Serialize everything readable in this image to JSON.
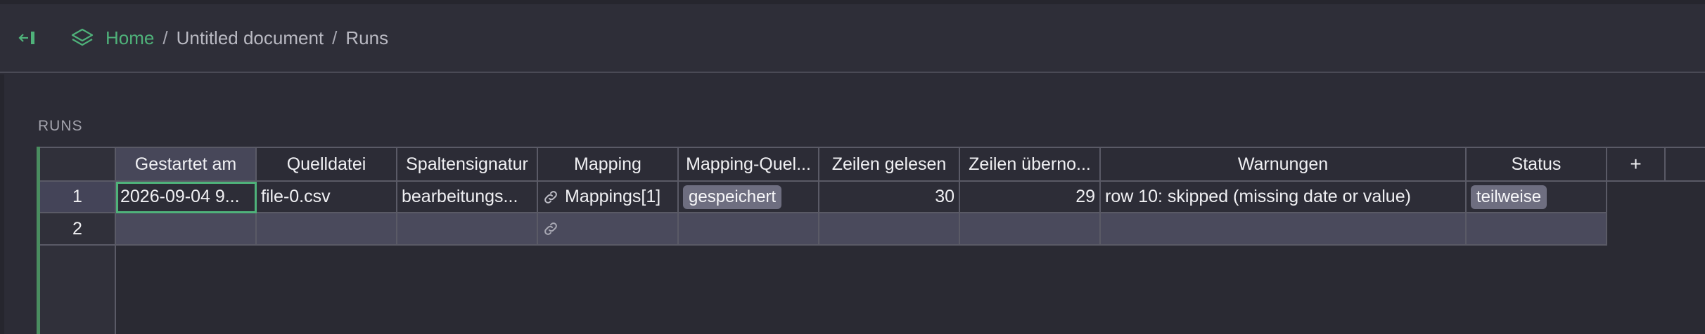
{
  "breadcrumb": {
    "home": "Home",
    "separator": "/",
    "document": "Untitled document",
    "current": "Runs"
  },
  "section": {
    "label": "RUNS"
  },
  "table": {
    "columns": [
      "Gestartet am",
      "Quelldatei",
      "Spaltensignatur",
      "Mapping",
      "Mapping-Quel...",
      "Zeilen gelesen",
      "Zeilen überno...",
      "Warnungen",
      "Status"
    ],
    "add_column": "+",
    "rows": [
      {
        "num": "1",
        "gestartet_am": "2026-09-04 9...",
        "quelldatei": "file-0.csv",
        "spaltensignatur": "bearbeitungs...",
        "mapping": "Mappings[1]",
        "mapping_quelle": "gespeichert",
        "zeilen_gelesen": "30",
        "zeilen_uebernommen": "29",
        "warnungen": "row 10: skipped (missing date or value)",
        "status": "teilweise"
      },
      {
        "num": "2",
        "gestartet_am": "",
        "quelldatei": "",
        "spaltensignatur": "",
        "mapping": "",
        "mapping_quelle": "",
        "zeilen_gelesen": "",
        "zeilen_uebernommen": "",
        "warnungen": "",
        "status": ""
      }
    ]
  },
  "colors": {
    "accent": "#4fb27a",
    "pill": "#6e6e80"
  }
}
